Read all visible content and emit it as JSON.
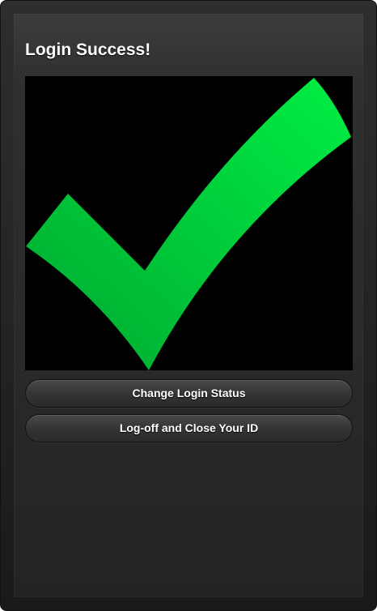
{
  "page": {
    "title": "Login Success!"
  },
  "image": {
    "icon": "checkmark-icon",
    "colors": {
      "background": "#000000",
      "check_light": "#00ee44",
      "check_dark": "#00a830"
    }
  },
  "buttons": {
    "change_status_label": "Change Login Status",
    "logoff_label": "Log-off and Close Your ID"
  }
}
